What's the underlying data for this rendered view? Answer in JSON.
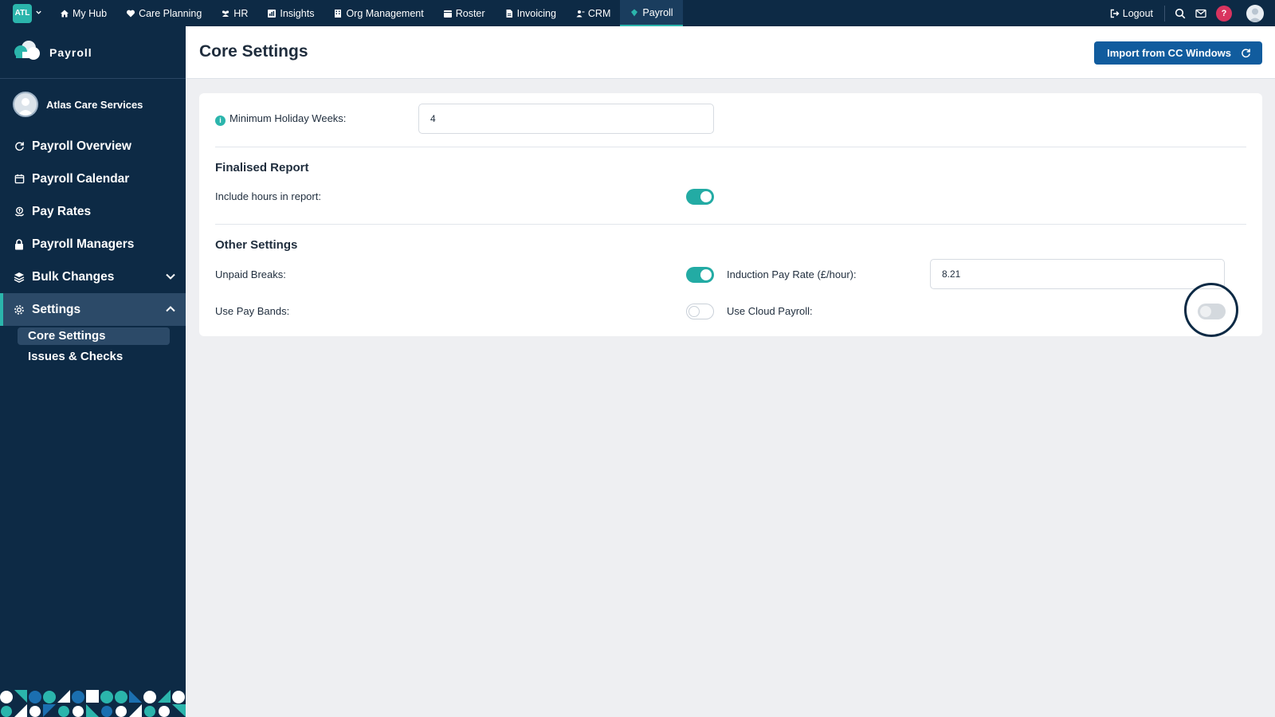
{
  "topbar": {
    "org_badge": "ATL",
    "nav": [
      {
        "label": "My Hub",
        "icon": "home-icon"
      },
      {
        "label": "Care Planning",
        "icon": "heart-icon"
      },
      {
        "label": "HR",
        "icon": "people-icon"
      },
      {
        "label": "Insights",
        "icon": "chart-icon"
      },
      {
        "label": "Org Management",
        "icon": "building-icon"
      },
      {
        "label": "Roster",
        "icon": "calendar-icon"
      },
      {
        "label": "Invoicing",
        "icon": "document-icon"
      },
      {
        "label": "CRM",
        "icon": "user-icon"
      },
      {
        "label": "Payroll",
        "icon": "diamond-icon",
        "active": true
      }
    ],
    "logout_label": "Logout",
    "help_label": "?"
  },
  "sidebar": {
    "brand": "Payroll",
    "org_name": "Atlas Care Services",
    "items": [
      {
        "label": "Payroll Overview",
        "icon": "refresh-icon"
      },
      {
        "label": "Payroll Calendar",
        "icon": "calendar-icon"
      },
      {
        "label": "Pay Rates",
        "icon": "money-icon"
      },
      {
        "label": "Payroll Managers",
        "icon": "lock-icon"
      },
      {
        "label": "Bulk Changes",
        "icon": "layers-icon",
        "expanded": false
      },
      {
        "label": "Settings",
        "icon": "gear-icon",
        "expanded": true,
        "active": true
      }
    ],
    "settings_sub": [
      {
        "label": "Core Settings",
        "active": true
      },
      {
        "label": "Issues & Checks"
      }
    ]
  },
  "header": {
    "title": "Core Settings",
    "import_button": "Import from CC Windows"
  },
  "settings": {
    "min_holiday_label": "Minimum Holiday Weeks:",
    "min_holiday_value": "4",
    "finalised_title": "Finalised Report",
    "include_hours_label": "Include hours in report:",
    "include_hours_on": true,
    "other_title": "Other Settings",
    "unpaid_breaks_label": "Unpaid Breaks:",
    "unpaid_breaks_on": true,
    "induction_label": "Induction Pay Rate (£/hour):",
    "induction_value": "8.21",
    "pay_bands_label": "Use Pay Bands:",
    "pay_bands_on": false,
    "cloud_payroll_label": "Use Cloud Payroll:",
    "cloud_payroll_on": false,
    "cloud_payroll_disabled": true
  },
  "colors": {
    "navy": "#0d2a45",
    "teal": "#2bb5ac",
    "button_blue": "#115c9e",
    "help_red": "#d9345f"
  }
}
